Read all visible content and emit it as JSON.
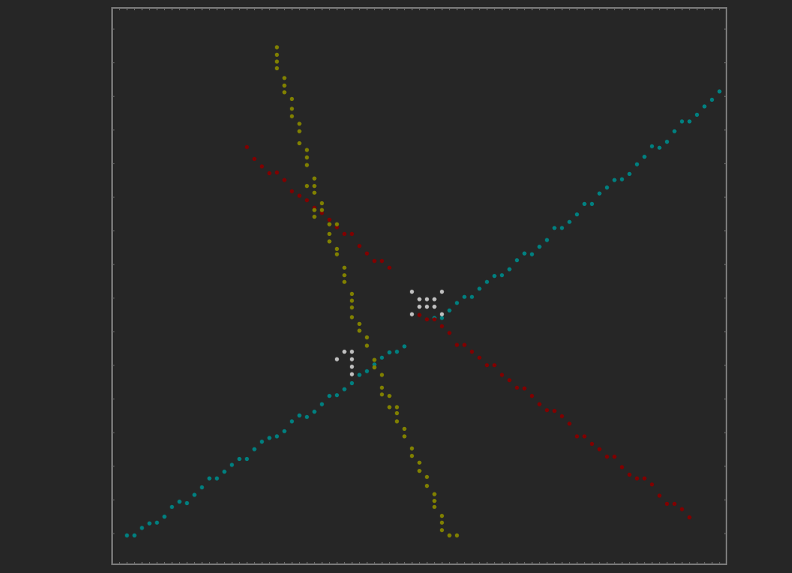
{
  "chart_data": {
    "type": "scatter",
    "title": "",
    "xlabel": "",
    "ylabel": "",
    "xlim": [
      0,
      82
    ],
    "ylim": [
      0,
      71
    ],
    "grid": false,
    "legend": "none",
    "series": [
      {
        "color": "#008080",
        "points": [
          [
            1.5,
            3.9
          ],
          [
            2.5,
            3.9
          ],
          [
            3.5,
            4.9
          ],
          [
            4.5,
            5.5
          ],
          [
            5.5,
            5.6
          ],
          [
            6.5,
            6.4
          ],
          [
            7.5,
            7.7
          ],
          [
            8.5,
            8.4
          ],
          [
            9.5,
            8.2
          ],
          [
            10.5,
            9.3
          ],
          [
            11.5,
            10.3
          ],
          [
            12.5,
            11.5
          ],
          [
            13.5,
            11.5
          ],
          [
            14.5,
            12.4
          ],
          [
            15.5,
            13.3
          ],
          [
            16.5,
            14.1
          ],
          [
            17.5,
            14.1
          ],
          [
            18.5,
            15.4
          ],
          [
            19.5,
            16.4
          ],
          [
            20.5,
            16.9
          ],
          [
            21.5,
            17.1
          ],
          [
            22.5,
            17.8
          ],
          [
            23.5,
            19.1
          ],
          [
            24.5,
            19.9
          ],
          [
            25.5,
            19.7
          ],
          [
            26.5,
            20.4
          ],
          [
            27.5,
            21.4
          ],
          [
            28.5,
            22.5
          ],
          [
            29.5,
            22.6
          ],
          [
            30.5,
            23.4
          ],
          [
            31.5,
            24.2
          ],
          [
            32.5,
            25.3
          ],
          [
            33.5,
            25.8
          ],
          [
            34.5,
            26.7
          ],
          [
            35.5,
            27.6
          ],
          [
            36.5,
            28.3
          ],
          [
            37.5,
            28.4
          ],
          [
            38.5,
            29.1
          ],
          [
            42.5,
            32.9
          ],
          [
            43.5,
            32.9
          ],
          [
            44.5,
            33.9
          ],
          [
            45.5,
            34.9
          ],
          [
            46.5,
            35.7
          ],
          [
            47.5,
            35.7
          ],
          [
            48.5,
            36.8
          ],
          [
            49.5,
            37.7
          ],
          [
            50.5,
            38.5
          ],
          [
            51.5,
            38.6
          ],
          [
            52.5,
            39.4
          ],
          [
            53.5,
            40.6
          ],
          [
            54.5,
            41.5
          ],
          [
            55.5,
            41.4
          ],
          [
            56.5,
            42.4
          ],
          [
            57.5,
            43.3
          ],
          [
            58.5,
            44.9
          ],
          [
            59.5,
            44.9
          ],
          [
            60.5,
            45.7
          ],
          [
            61.5,
            46.7
          ],
          [
            62.5,
            48.1
          ],
          [
            63.5,
            48.1
          ],
          [
            64.5,
            49.5
          ],
          [
            65.5,
            50.3
          ],
          [
            66.5,
            51.3
          ],
          [
            67.5,
            51.4
          ],
          [
            68.5,
            52.1
          ],
          [
            69.5,
            53.4
          ],
          [
            70.5,
            54.4
          ],
          [
            71.5,
            55.8
          ],
          [
            72.5,
            55.6
          ],
          [
            73.5,
            56.4
          ],
          [
            74.5,
            57.8
          ],
          [
            75.5,
            59.1
          ],
          [
            76.5,
            59.1
          ],
          [
            77.5,
            60.0
          ],
          [
            78.5,
            61.1
          ],
          [
            79.5,
            62.0
          ],
          [
            80.5,
            63.1
          ]
        ]
      },
      {
        "color": "#800000",
        "points": [
          [
            17.5,
            55.7
          ],
          [
            18.5,
            54.1
          ],
          [
            19.5,
            53.1
          ],
          [
            20.5,
            52.2
          ],
          [
            21.5,
            52.3
          ],
          [
            22.5,
            51.3
          ],
          [
            23.5,
            49.8
          ],
          [
            24.5,
            49.2
          ],
          [
            25.5,
            48.6
          ],
          [
            26.5,
            47.6
          ],
          [
            27.5,
            46.9
          ],
          [
            28.5,
            46.0
          ],
          [
            29.5,
            45.0
          ],
          [
            30.5,
            44.1
          ],
          [
            31.5,
            44.1
          ],
          [
            32.5,
            42.5
          ],
          [
            33.5,
            41.5
          ],
          [
            34.5,
            40.5
          ],
          [
            35.5,
            40.5
          ],
          [
            36.5,
            39.6
          ],
          [
            40.5,
            33.3
          ],
          [
            41.5,
            32.7
          ],
          [
            42.5,
            32.7
          ],
          [
            43.5,
            31.8
          ],
          [
            44.5,
            30.9
          ],
          [
            45.5,
            29.3
          ],
          [
            46.5,
            29.3
          ],
          [
            47.5,
            28.4
          ],
          [
            48.5,
            27.6
          ],
          [
            49.5,
            26.6
          ],
          [
            50.5,
            26.6
          ],
          [
            51.5,
            25.3
          ],
          [
            52.5,
            24.6
          ],
          [
            53.5,
            23.6
          ],
          [
            54.5,
            23.5
          ],
          [
            55.5,
            22.5
          ],
          [
            56.5,
            21.4
          ],
          [
            57.5,
            20.6
          ],
          [
            58.5,
            20.5
          ],
          [
            59.5,
            19.8
          ],
          [
            60.5,
            18.8
          ],
          [
            61.5,
            17.1
          ],
          [
            62.5,
            17.1
          ],
          [
            63.5,
            16.1
          ],
          [
            64.5,
            15.4
          ],
          [
            65.5,
            14.4
          ],
          [
            66.5,
            14.4
          ],
          [
            67.5,
            13.0
          ],
          [
            68.5,
            12.0
          ],
          [
            69.5,
            11.5
          ],
          [
            70.5,
            11.5
          ],
          [
            71.5,
            10.7
          ],
          [
            72.5,
            9.2
          ],
          [
            73.5,
            8.1
          ],
          [
            74.5,
            8.1
          ],
          [
            75.5,
            7.4
          ],
          [
            76.5,
            6.3
          ]
        ]
      },
      {
        "color": "#808000",
        "points": [
          [
            21.5,
            69.0
          ],
          [
            21.5,
            68.0
          ],
          [
            21.5,
            67.1
          ],
          [
            21.5,
            66.2
          ],
          [
            22.5,
            64.9
          ],
          [
            22.5,
            63.9
          ],
          [
            22.5,
            63.0
          ],
          [
            23.5,
            62.1
          ],
          [
            23.5,
            60.8
          ],
          [
            23.5,
            59.8
          ],
          [
            24.5,
            58.8
          ],
          [
            24.5,
            57.8
          ],
          [
            24.5,
            56.2
          ],
          [
            25.5,
            55.3
          ],
          [
            25.5,
            54.3
          ],
          [
            25.5,
            53.3
          ],
          [
            26.5,
            51.5
          ],
          [
            26.5,
            50.5
          ],
          [
            25.5,
            50.5
          ],
          [
            26.5,
            49.6
          ],
          [
            27.5,
            48.2
          ],
          [
            26.5,
            47.3
          ],
          [
            27.5,
            47.3
          ],
          [
            26.5,
            46.4
          ],
          [
            28.5,
            45.4
          ],
          [
            29.5,
            45.4
          ],
          [
            28.5,
            44.1
          ],
          [
            28.5,
            43.1
          ],
          [
            29.5,
            42.1
          ],
          [
            29.5,
            41.4
          ],
          [
            30.5,
            39.6
          ],
          [
            30.5,
            38.6
          ],
          [
            30.5,
            37.7
          ],
          [
            31.5,
            36.1
          ],
          [
            31.5,
            35.2
          ],
          [
            31.5,
            34.3
          ],
          [
            31.5,
            33.0
          ],
          [
            32.5,
            32.1
          ],
          [
            32.5,
            31.2
          ],
          [
            33.5,
            30.3
          ],
          [
            33.5,
            29.2
          ],
          [
            34.5,
            27.3
          ],
          [
            34.5,
            26.3
          ],
          [
            35.5,
            25.3
          ],
          [
            35.5,
            23.6
          ],
          [
            35.5,
            22.7
          ],
          [
            36.5,
            22.5
          ],
          [
            36.5,
            21.0
          ],
          [
            37.5,
            21.0
          ],
          [
            37.5,
            20.2
          ],
          [
            37.5,
            19.1
          ],
          [
            38.5,
            18.1
          ],
          [
            38.5,
            17.1
          ],
          [
            39.5,
            15.5
          ],
          [
            39.5,
            14.5
          ],
          [
            40.5,
            13.6
          ],
          [
            40.5,
            12.5
          ],
          [
            41.5,
            11.7
          ],
          [
            41.5,
            10.5
          ],
          [
            42.5,
            9.4
          ],
          [
            42.5,
            8.5
          ],
          [
            42.5,
            7.7
          ],
          [
            43.5,
            6.5
          ],
          [
            43.5,
            5.6
          ],
          [
            43.5,
            4.6
          ],
          [
            44.5,
            3.9
          ],
          [
            45.5,
            3.9
          ]
        ]
      },
      {
        "color": "#c0c0c0",
        "points": [
          [
            39.5,
            36.4
          ],
          [
            43.5,
            36.4
          ],
          [
            40.5,
            35.4
          ],
          [
            41.5,
            35.4
          ],
          [
            42.5,
            35.4
          ],
          [
            40.5,
            34.4
          ],
          [
            41.5,
            34.4
          ],
          [
            42.5,
            34.4
          ],
          [
            39.5,
            33.4
          ],
          [
            43.5,
            33.4
          ],
          [
            30.5,
            28.4
          ],
          [
            31.5,
            28.4
          ],
          [
            29.5,
            27.4
          ],
          [
            31.5,
            27.4
          ],
          [
            31.5,
            26.4
          ],
          [
            31.5,
            25.4
          ]
        ]
      }
    ]
  }
}
